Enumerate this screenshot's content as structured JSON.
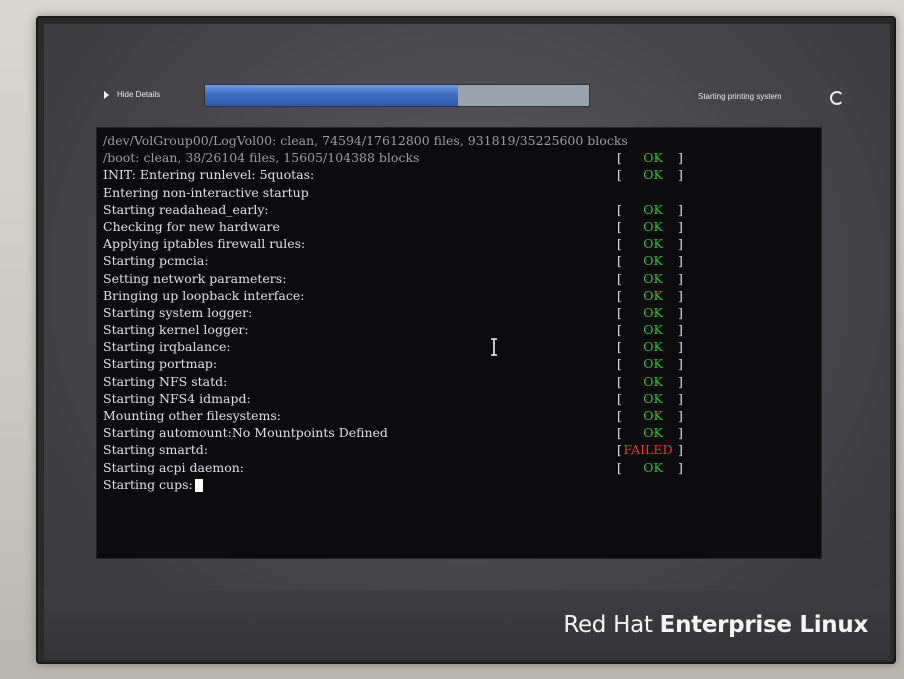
{
  "header": {
    "hide_details_label": "Hide Details",
    "status_text": "Starting printing system",
    "progress_fraction": 0.66
  },
  "console": {
    "lines": [
      {
        "text": "/dev/VolGroup00/LogVol00: clean, 74594/17612800 files, 931819/35225600 blocks",
        "status": "",
        "dim": true
      },
      {
        "text": "/boot: clean, 38/26104 files, 15605/104388 blocks",
        "status": "OK",
        "dim": true
      },
      {
        "text": "INIT: Entering runlevel: 5quotas:",
        "status": "OK",
        "dim": false
      },
      {
        "text": "Entering non-interactive startup",
        "status": "",
        "dim": false
      },
      {
        "text": "Starting readahead_early:",
        "status": "OK",
        "dim": false
      },
      {
        "text": "Checking for new hardware",
        "status": "OK",
        "dim": false
      },
      {
        "text": "Applying iptables firewall rules:",
        "status": "OK",
        "dim": false
      },
      {
        "text": "Starting pcmcia:",
        "status": "OK",
        "dim": false
      },
      {
        "text": "Setting network parameters:",
        "status": "OK",
        "dim": false
      },
      {
        "text": "Bringing up loopback interface:",
        "status": "OK",
        "dim": false
      },
      {
        "text": "Starting system logger:",
        "status": "OK",
        "dim": false
      },
      {
        "text": "Starting kernel logger:",
        "status": "OK",
        "dim": false
      },
      {
        "text": "Starting irqbalance:",
        "status": "OK",
        "dim": false
      },
      {
        "text": "Starting portmap:",
        "status": "OK",
        "dim": false
      },
      {
        "text": "Starting NFS statd:",
        "status": "OK",
        "dim": false
      },
      {
        "text": "Starting NFS4 idmapd:",
        "status": "OK",
        "dim": false
      },
      {
        "text": "Mounting other filesystems:",
        "status": "OK",
        "dim": false
      },
      {
        "text": "Starting automount:No Mountpoints Defined",
        "status": "OK",
        "dim": false
      },
      {
        "text": "Starting smartd:",
        "status": "FAILED",
        "dim": false
      },
      {
        "text": "Starting acpi daemon:",
        "status": "OK",
        "dim": false
      },
      {
        "text": "Starting cups:",
        "status": "",
        "dim": false,
        "cursor": true
      }
    ]
  },
  "footer": {
    "brand_part1": "Red Hat",
    "brand_part2": "Enterprise Linux"
  },
  "icons": {
    "expand": "triangle-right-icon",
    "spinner": "spinner-icon",
    "mouse": "ibeam-cursor-icon"
  },
  "colors": {
    "ok": "#2fbf3a",
    "failed": "#e33a2a",
    "progress": "#3d6fc2"
  }
}
